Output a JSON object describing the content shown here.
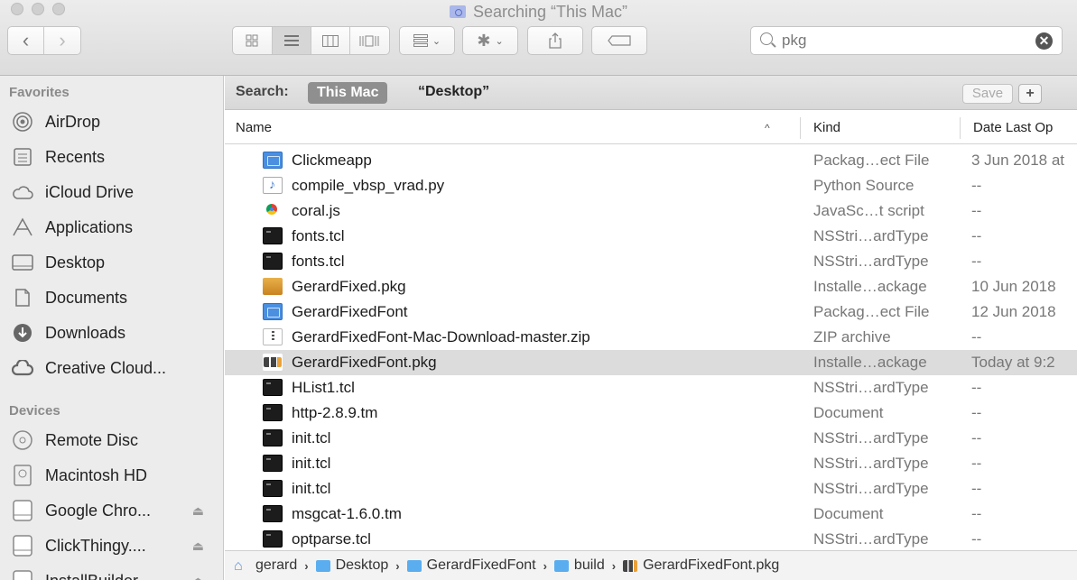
{
  "window": {
    "title": "Searching “This Mac”"
  },
  "toolbar": {
    "back": "‹",
    "forward": "›",
    "search": {
      "value": "pkg",
      "clear": "✕"
    }
  },
  "sidebar": {
    "favorites_header": "Favorites",
    "favorites": [
      {
        "label": "AirDrop",
        "icon": "airdrop-icon"
      },
      {
        "label": "Recents",
        "icon": "recents-icon"
      },
      {
        "label": "iCloud Drive",
        "icon": "cloud-icon"
      },
      {
        "label": "Applications",
        "icon": "applications-icon"
      },
      {
        "label": "Desktop",
        "icon": "desktop-icon"
      },
      {
        "label": "Documents",
        "icon": "documents-icon"
      },
      {
        "label": "Downloads",
        "icon": "downloads-icon"
      },
      {
        "label": "Creative Cloud...",
        "icon": "creative-cloud-icon"
      }
    ],
    "devices_header": "Devices",
    "devices": [
      {
        "label": "Remote Disc",
        "icon": "disc-icon"
      },
      {
        "label": "Macintosh HD",
        "icon": "harddrive-icon"
      },
      {
        "label": "Google Chro...",
        "icon": "drive-icon",
        "eject": "⏏"
      },
      {
        "label": "ClickThingy....",
        "icon": "drive-icon",
        "eject": "⏏"
      },
      {
        "label": "InstallBuilder...",
        "icon": "drive-icon",
        "eject": "⏏"
      }
    ]
  },
  "scope": {
    "label": "Search:",
    "this_mac": "This Mac",
    "desktop": "“Desktop”",
    "save": "Save",
    "add": "+"
  },
  "columns": {
    "name": "Name",
    "sort": "^",
    "kind": "Kind",
    "date": "Date Last Op"
  },
  "files": [
    {
      "name": "Clickmeapp",
      "kind": "Packag…ect File",
      "date": "3 Jun 2018 at",
      "icon": "app"
    },
    {
      "name": "compile_vbsp_vrad.py",
      "kind": "Python Source",
      "date": "--",
      "icon": "py"
    },
    {
      "name": "coral.js",
      "kind": "JavaSc…t script",
      "date": "--",
      "icon": "js"
    },
    {
      "name": "fonts.tcl",
      "kind": "NSStri…ardType",
      "date": "--",
      "icon": "term"
    },
    {
      "name": "fonts.tcl",
      "kind": "NSStri…ardType",
      "date": "--",
      "icon": "term"
    },
    {
      "name": "GerardFixed.pkg",
      "kind": "Installe…ackage",
      "date": "10 Jun 2018",
      "icon": "pkg"
    },
    {
      "name": "GerardFixedFont",
      "kind": "Packag…ect File",
      "date": "12 Jun 2018",
      "icon": "app"
    },
    {
      "name": "GerardFixedFont-Mac-Download-master.zip",
      "kind": "ZIP archive",
      "date": "--",
      "icon": "zip"
    },
    {
      "name": "GerardFixedFont.pkg",
      "kind": "Installe…ackage",
      "date": "Today at 9:2",
      "icon": "pkg2",
      "selected": true
    },
    {
      "name": "HList1.tcl",
      "kind": "NSStri…ardType",
      "date": "--",
      "icon": "term"
    },
    {
      "name": "http-2.8.9.tm",
      "kind": "Document",
      "date": "--",
      "icon": "term"
    },
    {
      "name": "init.tcl",
      "kind": "NSStri…ardType",
      "date": "--",
      "icon": "term"
    },
    {
      "name": "init.tcl",
      "kind": "NSStri…ardType",
      "date": "--",
      "icon": "term"
    },
    {
      "name": "init.tcl",
      "kind": "NSStri…ardType",
      "date": "--",
      "icon": "term"
    },
    {
      "name": "msgcat-1.6.0.tm",
      "kind": "Document",
      "date": "--",
      "icon": "term"
    },
    {
      "name": "optparse.tcl",
      "kind": "NSStri…ardType",
      "date": "--",
      "icon": "term"
    }
  ],
  "pathbar": [
    {
      "label": "gerard",
      "icon": "home"
    },
    {
      "label": "Desktop",
      "icon": "folder"
    },
    {
      "label": "GerardFixedFont",
      "icon": "folder"
    },
    {
      "label": "build",
      "icon": "folder"
    },
    {
      "label": "GerardFixedFont.pkg",
      "icon": "pkg2"
    }
  ],
  "pathbar_separator": "›"
}
